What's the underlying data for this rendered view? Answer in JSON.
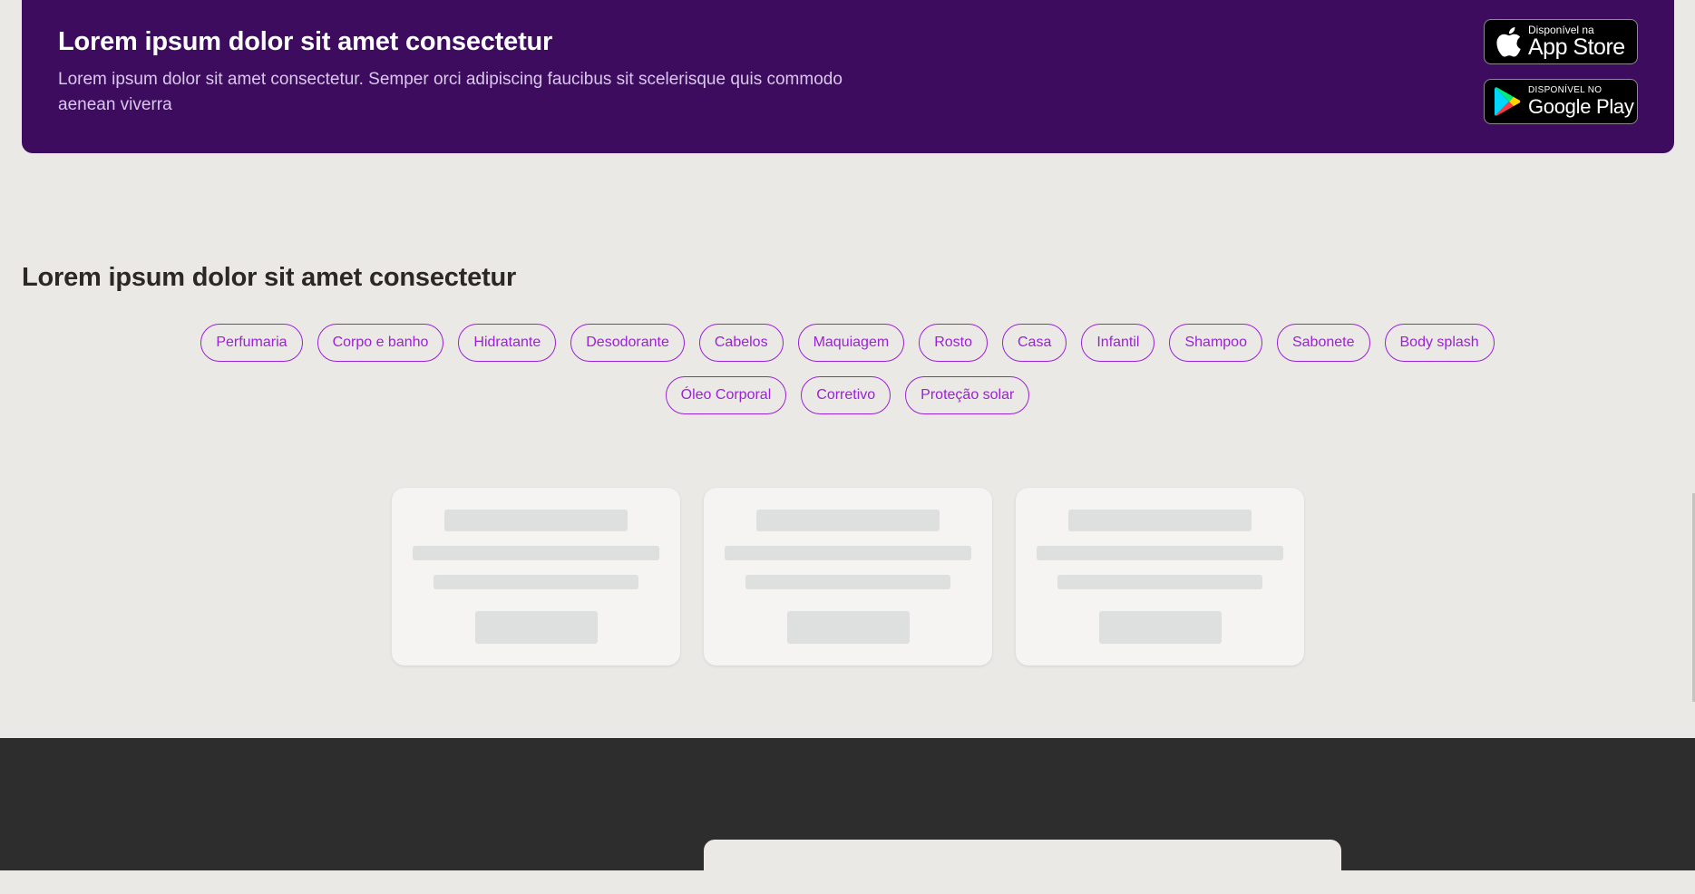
{
  "promo": {
    "title": "Lorem ipsum dolor sit amet consectetur",
    "text": "Lorem ipsum dolor sit amet consectetur. Semper orci adipiscing faucibus sit scelerisque quis commodo aenean viverra",
    "app_store": {
      "small": "Disponível na",
      "big": "App Store",
      "icon": "apple-icon"
    },
    "google_play": {
      "small": "DISPONÍVEL NO",
      "big": "Google Play",
      "icon": "google-play-icon"
    },
    "colors": {
      "background": "#3d0c5f"
    }
  },
  "categories": {
    "title": "Lorem ipsum dolor sit amet consectetur",
    "row1": [
      "Perfumaria",
      "Corpo e banho",
      "Hidratante",
      "Desodorante",
      "Cabelos",
      "Maquiagem",
      "Rosto",
      "Casa",
      "Infantil",
      "Shampoo",
      "Sabonete",
      "Body splash"
    ],
    "row2": [
      "Óleo Corporal",
      "Corretivo",
      "Proteção solar"
    ],
    "colors": {
      "chip_accent": "#9b22d6"
    }
  },
  "skeleton_cards": {
    "count": 3,
    "state": "loading"
  },
  "footer": {
    "card_title": "",
    "colors": {
      "background": "#2d2d2d"
    }
  }
}
